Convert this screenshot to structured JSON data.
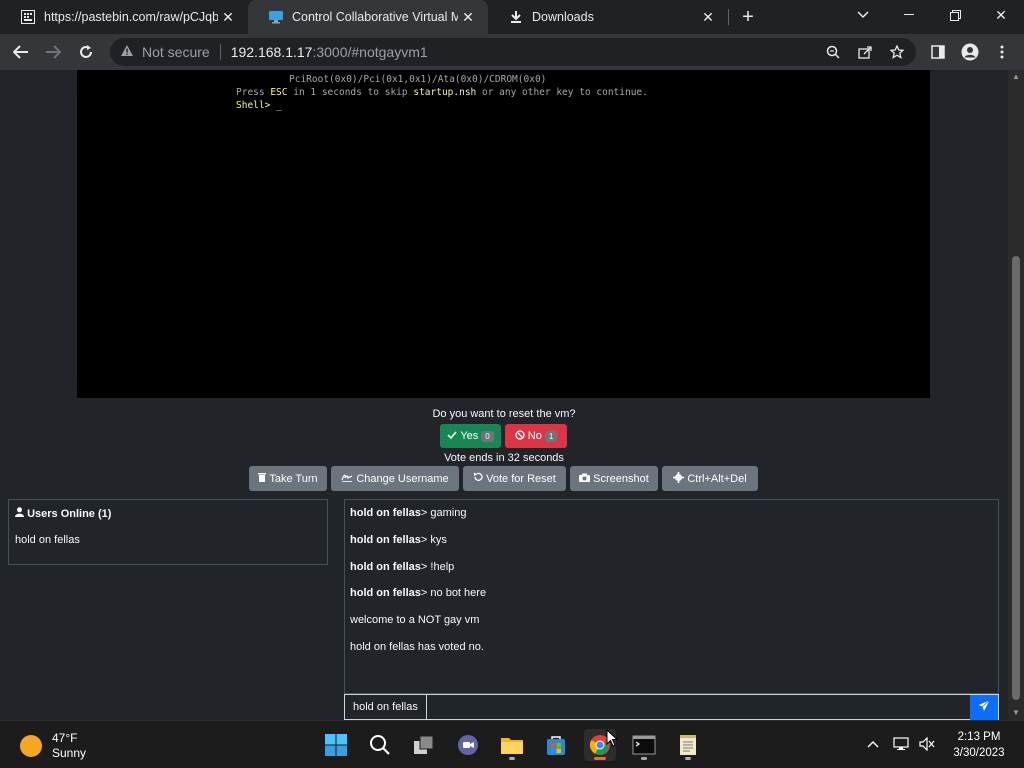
{
  "tabs": [
    {
      "title": "https://pastebin.com/raw/pCJqb",
      "icon": "pastebin-icon"
    },
    {
      "title": "Control Collaborative Virtual Mac",
      "icon": "monitor-icon"
    },
    {
      "title": "Downloads",
      "icon": "download-icon"
    }
  ],
  "address": {
    "security": "Not secure",
    "host": "192.168.1.17",
    "path": ":3000/#notgayvm1"
  },
  "vm_console": {
    "line1": "PciRoot(0x0)/Pci(0x1,0x1)/Ata(0x0)/CDROM(0x0)",
    "line2_a": "Press ",
    "line2_esc": "ESC",
    "line2_b": " in 1 seconds to skip ",
    "line2_file": "startup.nsh",
    "line2_c": " or any other key to continue.",
    "prompt": "Shell> _"
  },
  "vote": {
    "question": "Do you want to reset the vm?",
    "yes_label": "Yes",
    "yes_count": "0",
    "no_label": "No",
    "no_count": "1",
    "timer": "Vote ends in 32 seconds"
  },
  "controls": {
    "take_turn": "Take Turn",
    "change_username": "Change Username",
    "vote_reset": "Vote for Reset",
    "screenshot": "Screenshot",
    "ctrl_alt_del": "Ctrl+Alt+Del"
  },
  "users": {
    "header": "Users Online (1)",
    "list": [
      "hold on fellas"
    ]
  },
  "chat": {
    "messages": [
      {
        "user": "hold on fellas",
        "text": "gaming"
      },
      {
        "user": "hold on fellas",
        "text": "kys"
      },
      {
        "user": "hold on fellas",
        "text": "!help"
      },
      {
        "user": "hold on fellas",
        "text": "no bot here"
      },
      {
        "user": "",
        "text": "welcome to a NOT gay vm"
      },
      {
        "user": "",
        "text": "hold on fellas has voted no."
      }
    ],
    "sep": ">",
    "username": "hold on fellas",
    "input_value": ""
  },
  "taskbar": {
    "temp": "47°F",
    "condition": "Sunny",
    "time": "2:13 PM",
    "date": "3/30/2023"
  },
  "colors": {
    "yes": "#198754",
    "no": "#dc3545",
    "secondary": "#6c757d",
    "send": "#0d6efd"
  }
}
